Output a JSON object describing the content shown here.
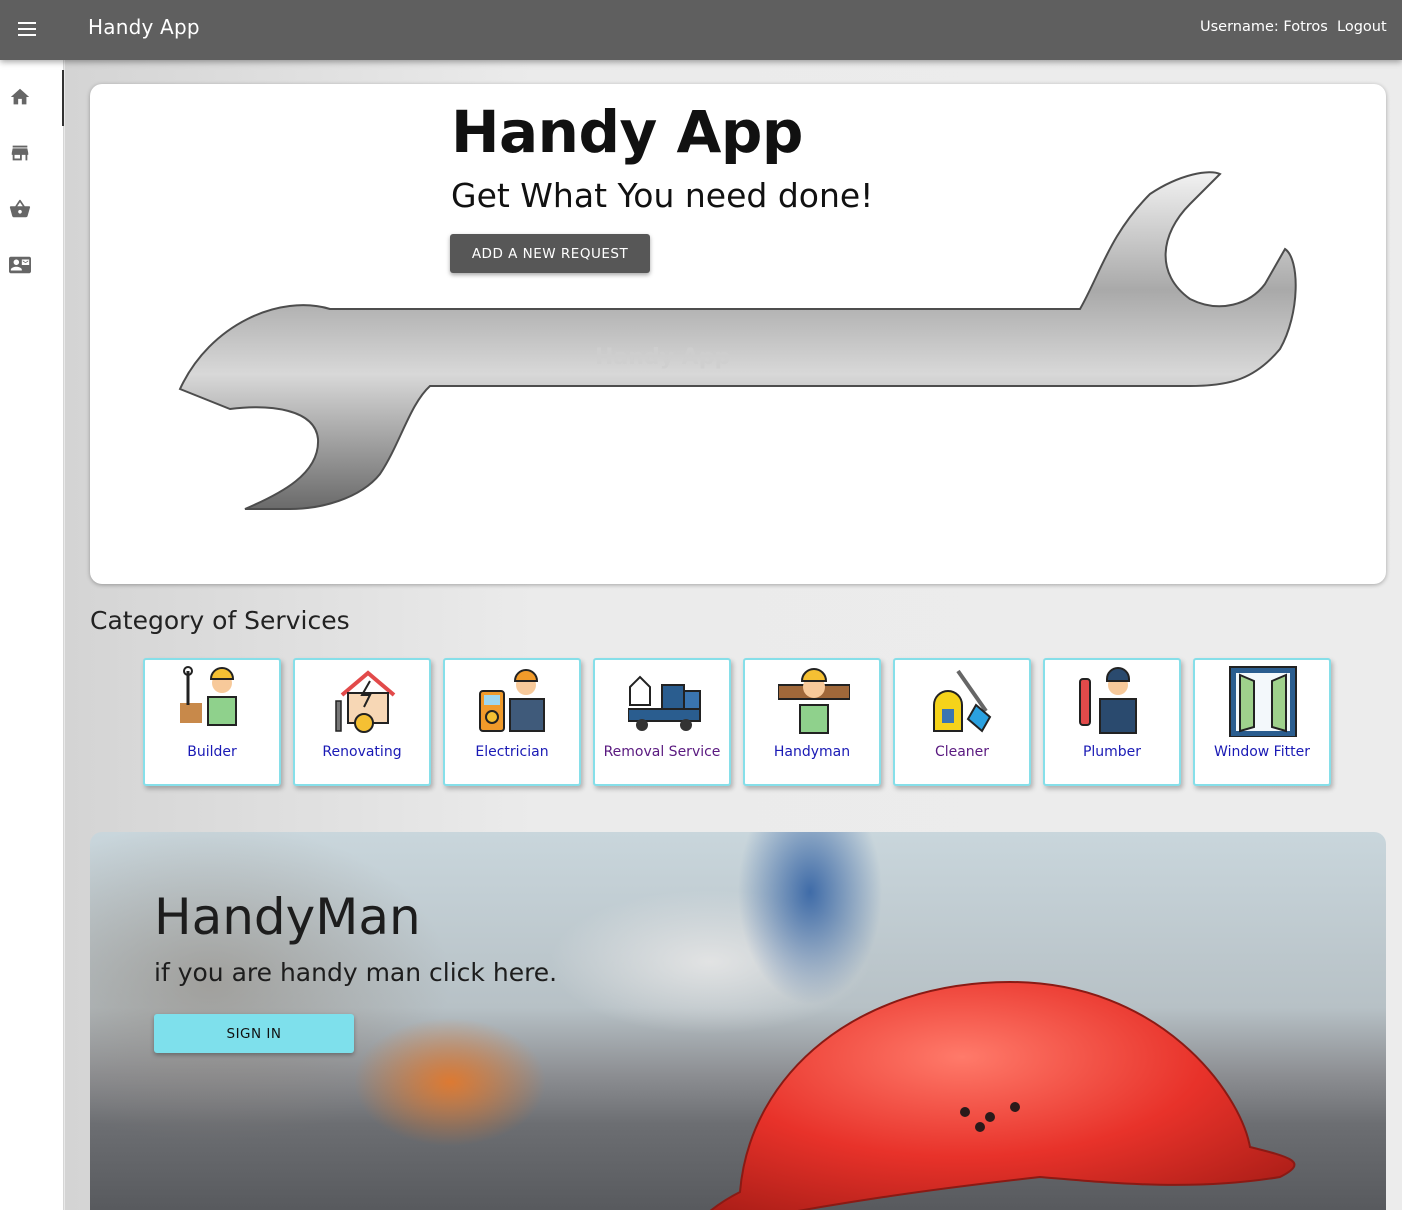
{
  "toolbar": {
    "title": "Handy App",
    "username": "Username: Fotros",
    "logout": "Logout"
  },
  "sidebar": {
    "items": [
      {
        "icon": "home-icon",
        "active": true
      },
      {
        "icon": "store-icon",
        "active": false
      },
      {
        "icon": "basket-icon",
        "active": false
      },
      {
        "icon": "contact-mail-icon",
        "active": false
      }
    ]
  },
  "hero": {
    "title": "Handy App",
    "subtitle": "Get What You need done!",
    "button": "ADD A NEW REQUEST",
    "wrench_engraving": "Handy App"
  },
  "categories": {
    "title": "Category of Services",
    "items": [
      {
        "label": "Builder",
        "icon": "builder-icon"
      },
      {
        "label": "Renovating",
        "icon": "renovating-icon"
      },
      {
        "label": "Electrician",
        "icon": "electrician-icon"
      },
      {
        "label": "Removal Service",
        "icon": "removal-truck-icon"
      },
      {
        "label": "Handyman",
        "icon": "handyman-icon"
      },
      {
        "label": "Cleaner",
        "icon": "pressure-washer-icon"
      },
      {
        "label": "Plumber",
        "icon": "plumber-icon"
      },
      {
        "label": "Window Fitter",
        "icon": "window-icon"
      }
    ]
  },
  "handyman": {
    "title": "HandyMan",
    "subtitle": "if you are handy man click here.",
    "button": "SIGN IN"
  },
  "colors": {
    "toolbar": "#5f5f5f",
    "card_border": "#86dfe9",
    "signin_button": "#7ee0ec",
    "category_label": "#1a1ab5"
  }
}
